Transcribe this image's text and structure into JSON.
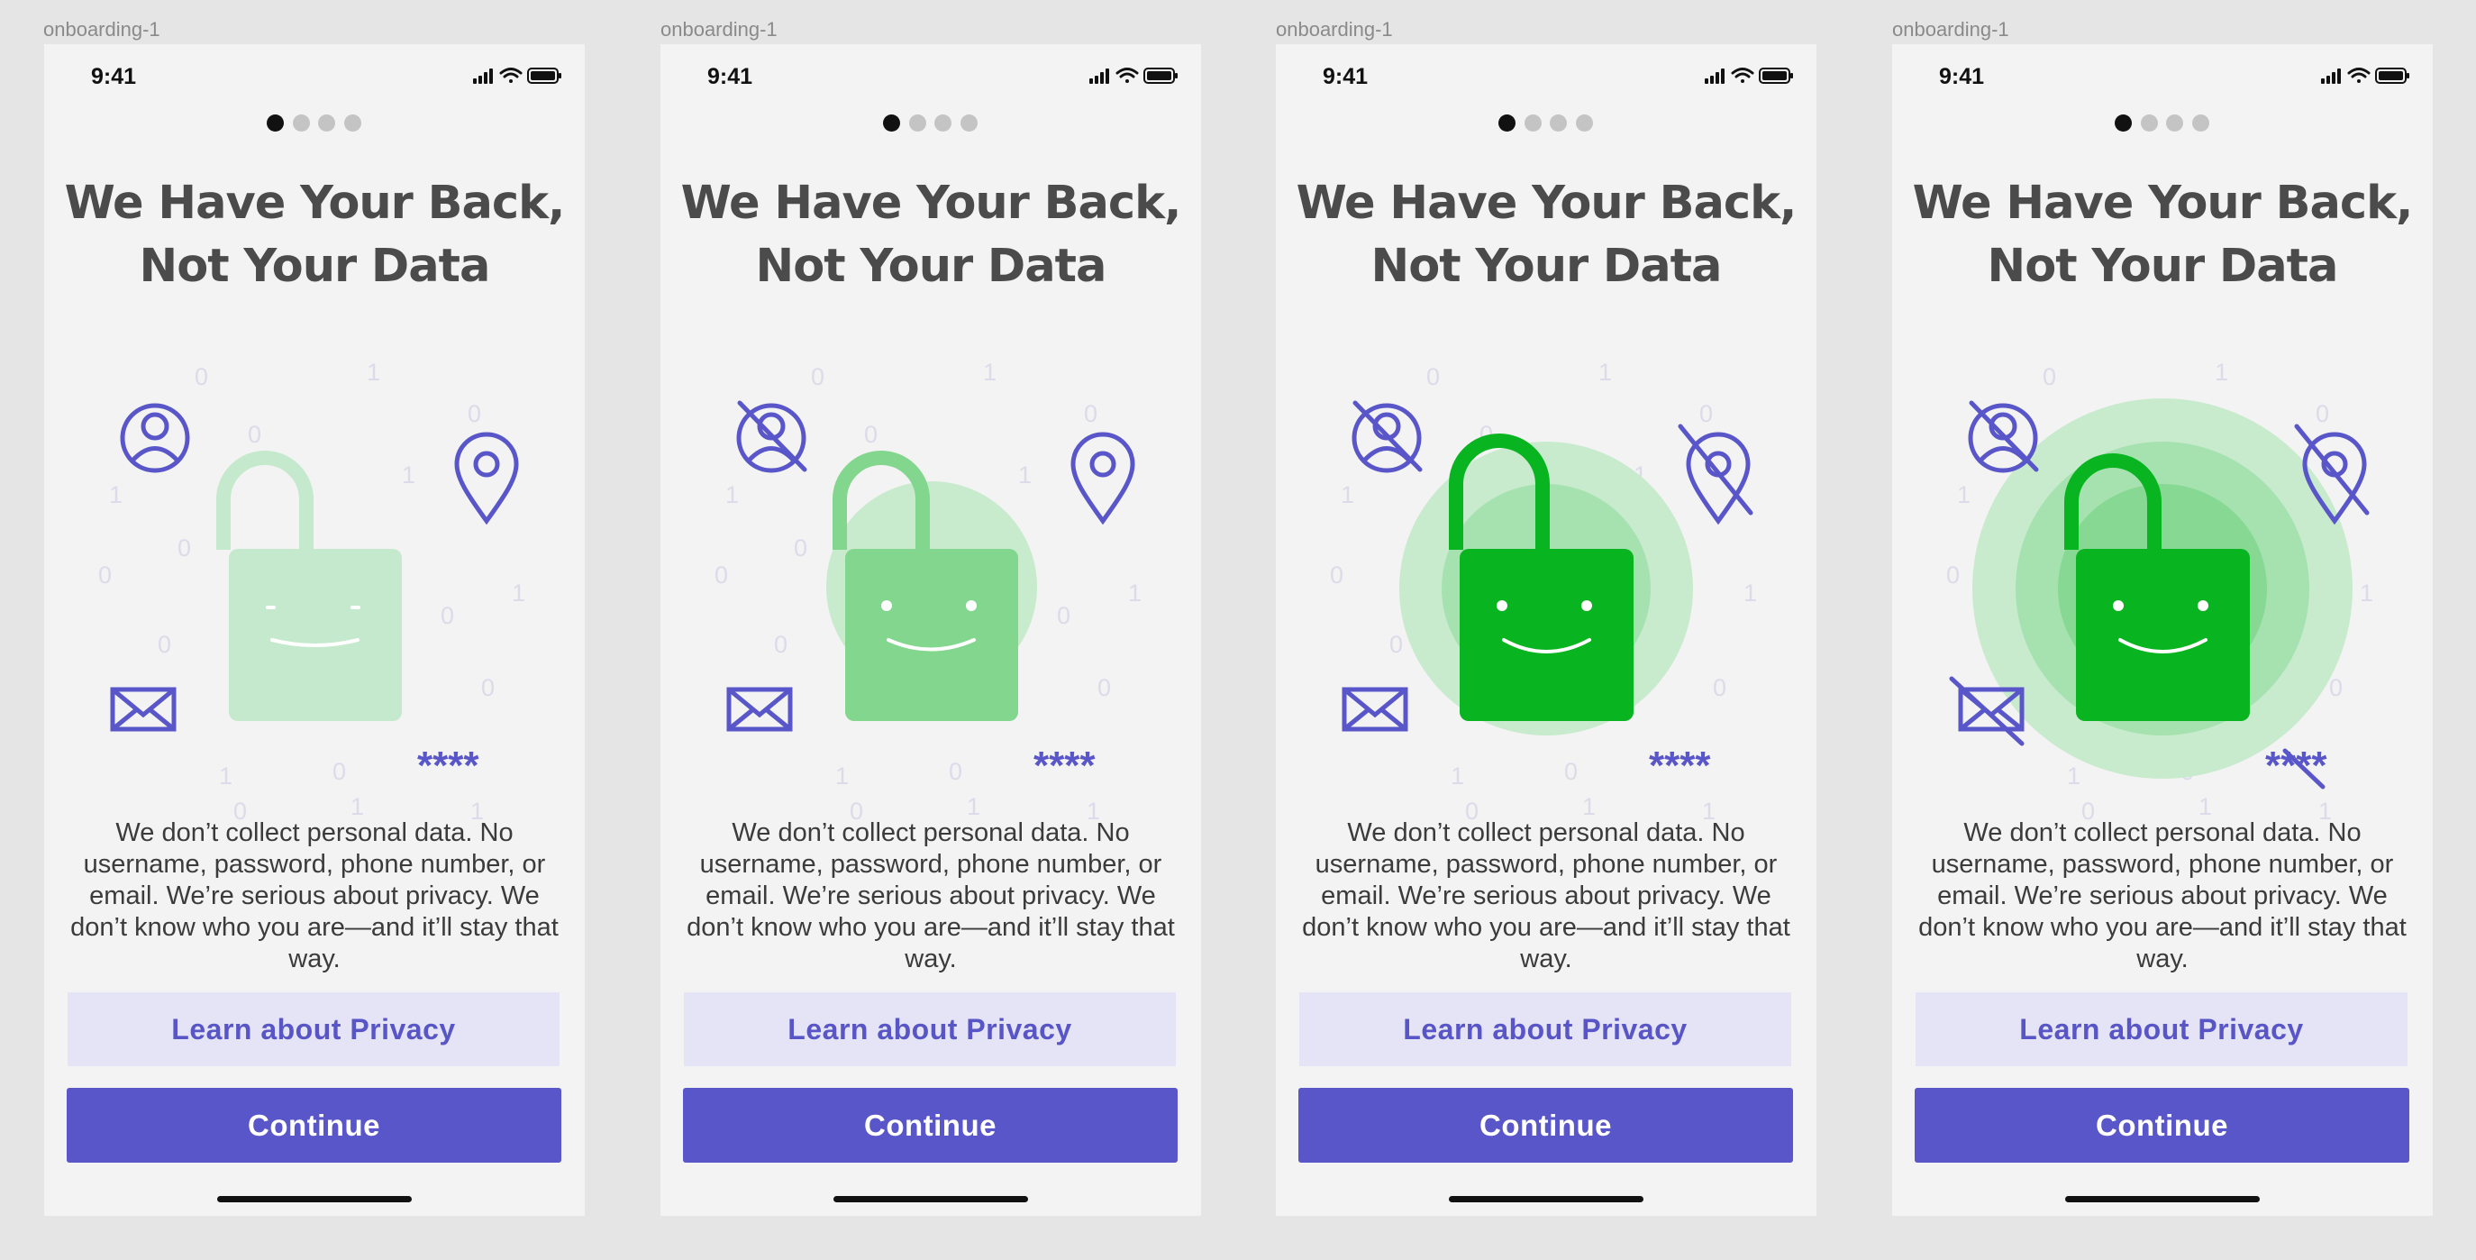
{
  "frames": [
    {
      "label": "onboarding-1",
      "time": "9:41",
      "title_line1": "We Have Your Back,",
      "title_line2": "Not Your Data",
      "description": "We don’t collect personal data. No username, password, phone number, or email. We’re serious about privacy. We don’t know who you are—and it’ll stay that way.",
      "learn_button": "Learn about Privacy",
      "continue_button": "Continue",
      "password_mask": "****",
      "stage": 1
    },
    {
      "label": "onboarding-1",
      "time": "9:41",
      "title_line1": "We Have Your Back,",
      "title_line2": "Not Your Data",
      "description": "We don’t collect personal data. No username, password, phone number, or email. We’re serious about privacy. We don’t know who you are—and it’ll stay that way.",
      "learn_button": "Learn about Privacy",
      "continue_button": "Continue",
      "password_mask": "****",
      "stage": 2
    },
    {
      "label": "onboarding-1",
      "time": "9:41",
      "title_line1": "We Have Your Back,",
      "title_line2": "Not Your Data",
      "description": "We don’t collect personal data. No username, password, phone number, or email. We’re serious about privacy. We don’t know who you are—and it’ll stay that way.",
      "learn_button": "Learn about Privacy",
      "continue_button": "Continue",
      "password_mask": "****",
      "stage": 3
    },
    {
      "label": "onboarding-1",
      "time": "9:41",
      "title_line1": "We Have Your Back,",
      "title_line2": "Not Your Data",
      "description": "We don’t collect personal data. No username, password, phone number, or email. We’re serious about privacy. We don’t know who you are—and it’ll stay that way.",
      "learn_button": "Learn about Privacy",
      "continue_button": "Continue",
      "password_mask": "****",
      "stage": 4
    }
  ],
  "pagination": {
    "total": 4,
    "active_index": 0
  },
  "binary_digits": [
    "0",
    "1",
    "0",
    "0",
    "1",
    "1",
    "0",
    "1",
    "0",
    "0",
    "0",
    "0",
    "1",
    "0",
    "1",
    "0",
    "1"
  ],
  "icons": [
    "user-icon",
    "location-pin-icon",
    "mail-icon",
    "lock-icon",
    "signal-icon",
    "wifi-icon",
    "battery-icon"
  ],
  "colors": {
    "accent": "#5956c9",
    "secondary_button_bg": "#e5e4f6",
    "phone_bg": "#f3f3f3",
    "canvas_bg": "#e5e5e5",
    "lock_light": "#c5e9cc",
    "lock_mid": "#82d68d",
    "lock_bright": "#08b420",
    "ring": "#a6e2b0",
    "digit": "#dcdbe9"
  }
}
